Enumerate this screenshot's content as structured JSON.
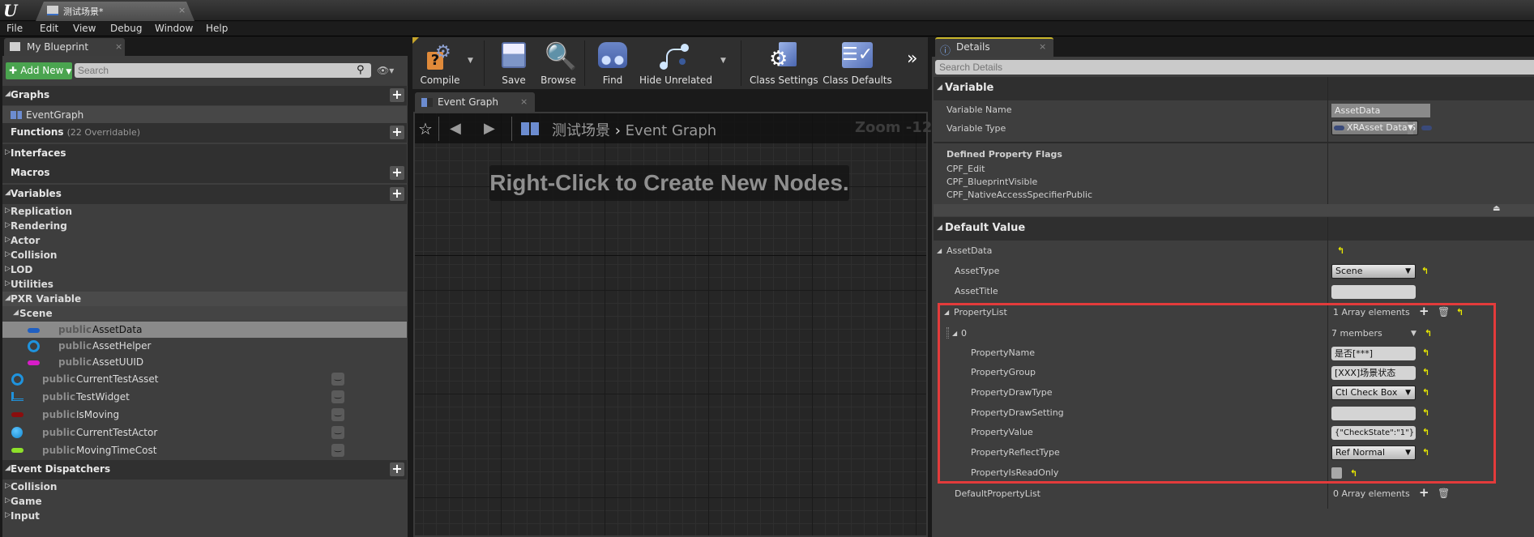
{
  "window": {
    "tab_title": "测试场景*",
    "tab_close": "×"
  },
  "menu": [
    "File",
    "Edit",
    "View",
    "Debug",
    "Window",
    "Help"
  ],
  "my_blueprint": {
    "tab_label": "My Blueprint",
    "tab_close": "×",
    "add_new_label": "Add New",
    "search_placeholder": "Search",
    "sections": {
      "graphs": "Graphs",
      "event_graph": "EventGraph",
      "functions": "Functions",
      "functions_sub": "(22 Overridable)",
      "interfaces": "Interfaces",
      "macros": "Macros",
      "variables": "Variables",
      "event_dispatchers": "Event Dispatchers"
    },
    "variable_categories": [
      "Replication",
      "Rendering",
      "Actor",
      "Collision",
      "LOD",
      "Utilities"
    ],
    "pxr_category": "PXR Variable",
    "scene_category": "Scene",
    "scene_variables": [
      {
        "access": "public",
        "name": "AssetData",
        "type_color": "#1f5fc2",
        "shape": "pill",
        "selected": true
      },
      {
        "access": "public",
        "name": "AssetHelper",
        "type_color": "#1f93dd",
        "shape": "ring",
        "selected": false
      },
      {
        "access": "public",
        "name": "AssetUUID",
        "type_color": "#d81cc8",
        "shape": "pill",
        "selected": false
      }
    ],
    "variables": [
      {
        "access": "public",
        "name": "CurrentTestAsset",
        "type_color": "#1f93dd",
        "shape": "ring"
      },
      {
        "access": "public",
        "name": "TestWidget",
        "type_color": "#1f93dd",
        "shape": "widget"
      },
      {
        "access": "public",
        "name": "IsMoving",
        "type_color": "#8b0d0d",
        "shape": "pill"
      },
      {
        "access": "public",
        "name": "CurrentTestActor",
        "type_color": "#18a0e8",
        "shape": "dot"
      },
      {
        "access": "public",
        "name": "MovingTimeCost",
        "type_color": "#8ee02a",
        "shape": "pill"
      }
    ],
    "dispatcher_categories": [
      "Collision",
      "Game",
      "Input"
    ]
  },
  "toolbar": {
    "compile": "Compile",
    "save": "Save",
    "browse": "Browse",
    "find": "Find",
    "hide_unrelated": "Hide Unrelated",
    "class_settings": "Class Settings",
    "class_defaults": "Class Defaults",
    "overflow": "»"
  },
  "graph": {
    "tab_label": "Event Graph",
    "tab_close": "×",
    "breadcrumb_root": "测试场景",
    "breadcrumb_sep": "›",
    "breadcrumb_leaf": "Event Graph",
    "zoom": "Zoom -12",
    "hint": "Right-Click to Create New Nodes."
  },
  "details": {
    "tab_label": "Details",
    "tab_close": "×",
    "search_placeholder": "Search Details",
    "variable_section": "Variable",
    "variable_name_label": "Variable Name",
    "variable_name_value": "AssetData",
    "variable_type_label": "Variable Type",
    "variable_type_value": "XRAsset Data S",
    "flags_title": "Defined Property Flags",
    "flags": [
      "CPF_Edit",
      "CPF_BlueprintVisible",
      "CPF_NativeAccessSpecifierPublic"
    ],
    "default_section": "Default Value",
    "asset_data": "AssetData",
    "asset_type_label": "AssetType",
    "asset_type_value": "Scene",
    "asset_title_label": "AssetTitle",
    "asset_title_value": "",
    "property_list_label": "PropertyList",
    "property_list_count": "1 Array elements",
    "element_index": "0",
    "element_members": "7 members",
    "property_name_label": "PropertyName",
    "property_name_value": "是否[***]",
    "property_group_label": "PropertyGroup",
    "property_group_value": "[XXX]场景状态",
    "property_draw_type_label": "PropertyDrawType",
    "property_draw_type_value": "Ctl Check Box",
    "property_draw_setting_label": "PropertyDrawSetting",
    "property_draw_setting_value": "",
    "property_value_label": "PropertyValue",
    "property_value_value": "{\"CheckState\":\"1\"}",
    "property_reflect_type_label": "PropertyReflectType",
    "property_reflect_type_value": "Ref Normal",
    "property_is_read_only_label": "PropertyIsReadOnly",
    "property_is_read_only_value": false,
    "default_property_list_label": "DefaultPropertyList",
    "default_property_list_count": "0 Array elements"
  },
  "colors": {
    "highlight_box": "#e33b3b",
    "add_new": "#4aa44f",
    "reset_arrow": "#e8e800",
    "details_tab_accent": "#c7b429"
  }
}
